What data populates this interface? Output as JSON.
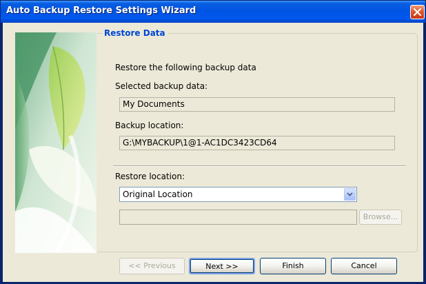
{
  "window": {
    "title": "Auto Backup Restore Settings Wizard"
  },
  "group": {
    "title": "Restore Data"
  },
  "content": {
    "intro": "Restore the following backup data",
    "selected_label": "Selected backup data:",
    "selected_value": "My Documents",
    "location_label": "Backup location:",
    "location_value": "G:\\MYBACKUP\\1@1-AC1DC3423CD64",
    "restore_label": "Restore location:",
    "restore_selected": "Original Location",
    "custom_path_value": "",
    "browse_label": "Browse..."
  },
  "buttons": {
    "previous": "<< Previous",
    "next": "Next >>",
    "finish": "Finish",
    "cancel": "Cancel"
  },
  "colors": {
    "titlebar": "#0054e3",
    "group_title": "#0046d5",
    "dialog_bg": "#ece9d8",
    "close_button": "#e2562a"
  },
  "icons": {
    "close": "close-icon",
    "dropdown": "chevron-down-icon"
  }
}
